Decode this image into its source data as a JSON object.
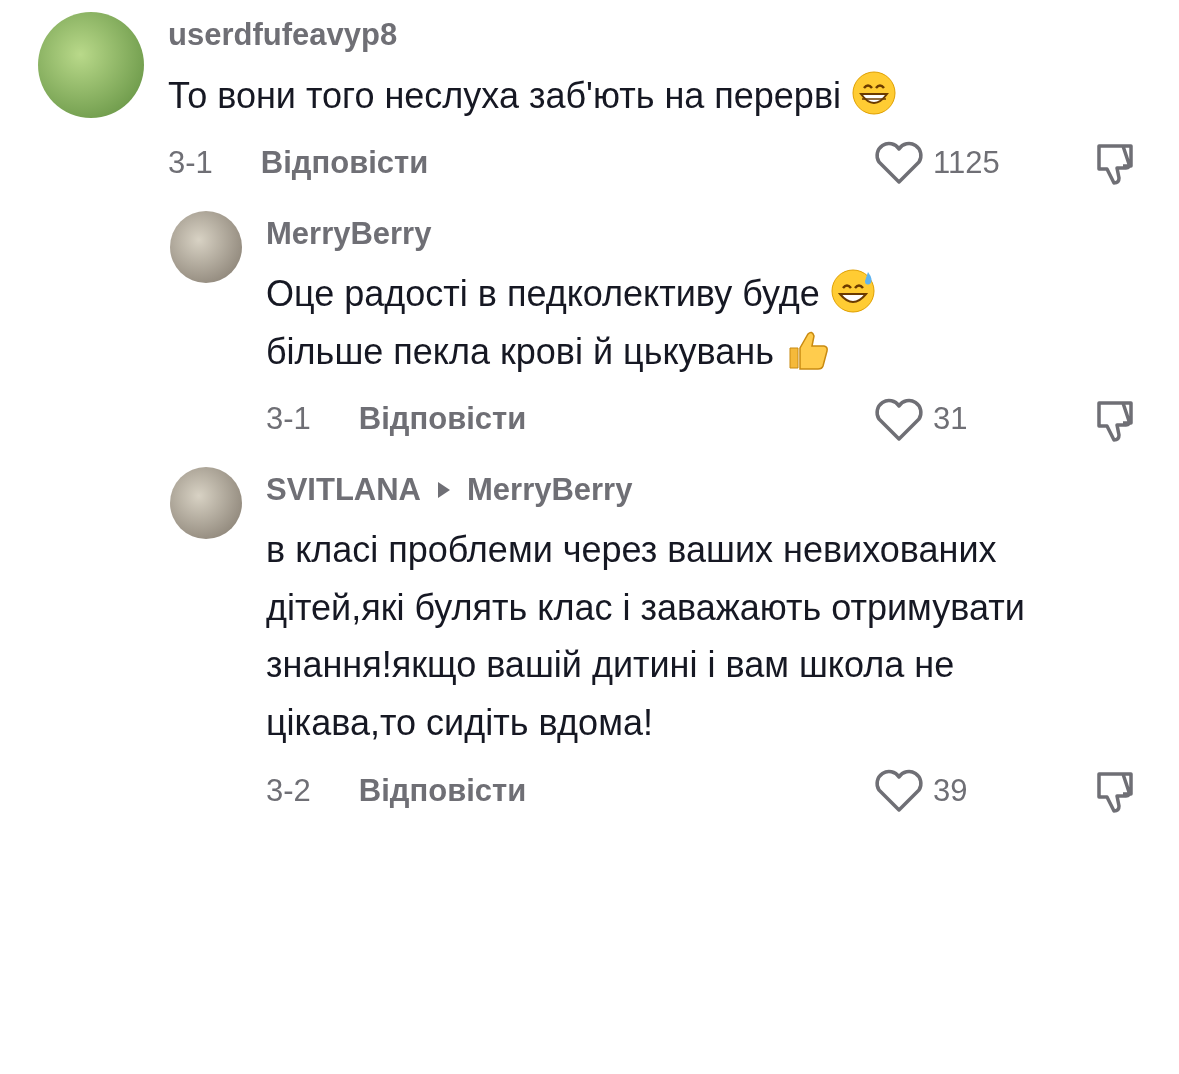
{
  "comments": [
    {
      "user": "userdfufeavyp8",
      "segments": [
        {
          "text": "То вони того неслуха заб'ють на перерві",
          "kind": "grin"
        }
      ],
      "date": "3-1",
      "reply_label": "Відповісти",
      "likes": "1125",
      "children": [
        {
          "user": "MerryBerry",
          "segments": [
            {
              "text": "Оце радості в педколективу буде",
              "kind": "sweat"
            },
            {
              "text": "більше пекла крові й цькувань",
              "kind": "thumbs-up"
            }
          ],
          "date": "3-1",
          "reply_label": "Відповісти",
          "likes": "31"
        },
        {
          "user": "SVITLANA",
          "reply_to": "MerryBerry",
          "segments": [
            {
              "text": "в класі проблеми через ваших невихованих дітей,які булять клас і заважають отримувати знання!якщо вашій дитині і вам школа не цікава,то сидіть вдома!"
            }
          ],
          "date": "3-2",
          "reply_label": "Відповісти",
          "likes": "39"
        }
      ]
    }
  ]
}
